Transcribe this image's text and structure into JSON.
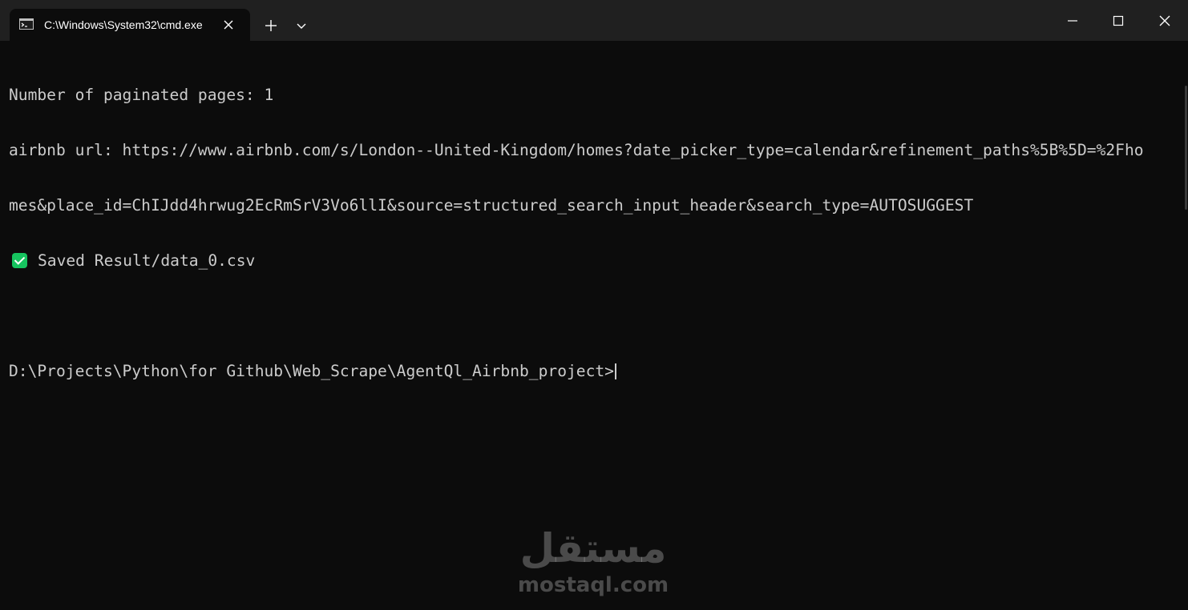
{
  "tab": {
    "title": "C:\\Windows\\System32\\cmd.exe",
    "icon": "terminal-icon"
  },
  "toolbar": {
    "new_tab_icon": "plus-icon",
    "dropdown_icon": "chevron-down-icon"
  },
  "window_controls": {
    "minimize_icon": "minimize-icon",
    "maximize_icon": "maximize-icon",
    "close_icon": "close-icon"
  },
  "terminal": {
    "lines": [
      "Number of paginated pages: 1",
      "airbnb url: https://www.airbnb.com/s/London--United-Kingdom/homes?date_picker_type=calendar&refinement_paths%5B%5D=%2Fho",
      "mes&place_id=ChIJdd4hrwug2EcRmSrV3Vo6llI&source=structured_search_input_header&search_type=AUTOSUGGEST",
      "Saved Result/data_0.csv",
      "",
      "D:\\Projects\\Python\\for Github\\Web_Scrape\\AgentQl_Airbnb_project>"
    ],
    "status_icon": "check-mark-icon"
  },
  "watermark": {
    "arabic": "مستقل",
    "latin": "mostaql.com"
  },
  "colors": {
    "background": "#0c0c0c",
    "titlebar": "#202020",
    "text": "#cccccc",
    "check": "#16c45f"
  }
}
